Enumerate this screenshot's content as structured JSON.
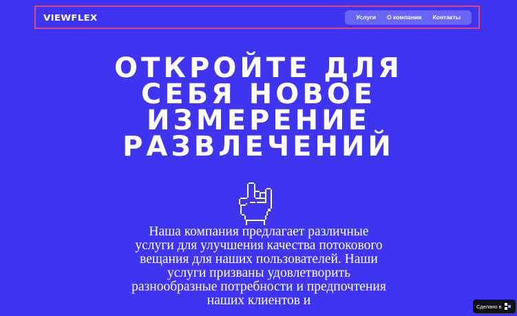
{
  "brand": {
    "logo_text": "VIEWFLEX"
  },
  "nav": {
    "items": [
      {
        "label": "Услуги"
      },
      {
        "label": "О компании"
      },
      {
        "label": "Контакты"
      }
    ]
  },
  "hero": {
    "title_lines": [
      "ОТКРОЙТЕ ДЛЯ",
      "СЕБЯ НОВОЕ",
      "ИЗМЕРЕНИЕ",
      "РАЗВЛЕЧЕНИЙ"
    ],
    "icon": "rock-hand-pixel-icon",
    "description": "Наша компания предлагает различные услуги для улучшения качества потокового вещания для наших пользователей. Наши услуги призваны удовлетворить разнообразные потребности и предпочтения наших клиентов и"
  },
  "badge": {
    "label": "Сделано в",
    "icon": "builder-logo-icon"
  },
  "colors": {
    "background": "#3f34f0",
    "header_outline": "#e0457a",
    "nav_background": "#6a66f5",
    "text": "#ffffff",
    "badge_background": "#121212"
  }
}
